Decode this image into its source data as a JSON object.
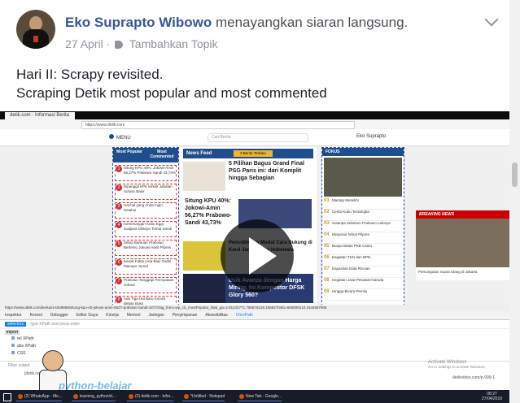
{
  "post": {
    "author_name": "Eko Suprapto Wibowo",
    "author_action": "menayangkan siaran langsung.",
    "date": "27 April",
    "separator": "·",
    "tag_label": "Tambahkan Topik",
    "line1": "Hari II: Scrapy revisited.",
    "line2": "Scraping Detik most popular and most commented"
  },
  "video": {
    "browser_tab": "detik.com - Informasi Berita Terkini",
    "url": "https://www.detik.com",
    "site": {
      "menu": "MENU",
      "search_placeholder": "Cari Berita",
      "user": "Eko Suprapto",
      "popular_tabs": [
        "Most Popular",
        "Most Commented"
      ],
      "popular_items": [
        {
          "n": "1",
          "t": "Situng KPU 40%: Jokowi-Amin 56,27% Prabowo-Sandi 43,73%"
        },
        {
          "n": "2",
          "t": "Dipanggil KPK terkait Jabatan Sofyan Basir"
        },
        {
          "n": "3",
          "t": "Hal-hal yang Anda Ingin Ketahui"
        },
        {
          "n": "4",
          "t": "Kemenangan Kubu Eggi Sudjana Dilanjut Tomat Sandi"
        },
        {
          "n": "5",
          "t": "Sebut Bantuan Prabowo Bertemu Jokowi Hasil Pilpres"
        },
        {
          "n": "6",
          "t": "Kenali Fakta Usia Bayi Gadis Manopo Jurnal"
        },
        {
          "n": "7",
          "t": "Prabowo Tanggapi Pernyataan Jokowi"
        },
        {
          "n": "8",
          "t": "Ada Tiga Hal Baru Komisi Bebas Bukti"
        },
        {
          "n": "9",
          "t": "Fakta Lain Kapal Ketidakrukunan"
        }
      ],
      "newsfeed_title": "News Feed",
      "newsfeed_badge": "3 Berita Terbaru",
      "newsfeed_items": [
        "5 Pilihan Bagus Grand Final PSG Paris ini: dari Komplit hingga Sebagian",
        "Situng KPU 40%: Jokowi-Amin 56,27% Prabowo-Sandi 43,73%",
        "Pencoblosan Modul Cara Dukung di Kecil Jadi Unggul Indonesia",
        "Usik Avanza dengan Harga Miring, Ini Kompetitor DFSK Glory 560?"
      ],
      "fokus_title": "FOKUS",
      "fokus_items": [
        {
          "n": "01",
          "t": "Mantap Memilih!"
        },
        {
          "n": "02",
          "t": "Cerita Kubu Tersangka"
        },
        {
          "n": "03",
          "t": "Sutanpa Sebelum Prabowo Lainnya"
        },
        {
          "n": "04",
          "t": "Eksposur Minat Pilpres"
        },
        {
          "n": "05",
          "t": "Buaya Batas PKB Cantu"
        },
        {
          "n": "06",
          "t": "Kegiatan TKN dan BPN"
        },
        {
          "n": "07",
          "t": "Kapasitas Data Rincian"
        },
        {
          "n": "08",
          "t": "Kegiatan Jasa Pesawat Garuda"
        },
        {
          "n": "09",
          "t": "Hingga Bicara Pemilu"
        }
      ],
      "breaking_title": "BREAKING NEWS",
      "breaking_caption": "Pemungutan Suara Ulang di Jakarta"
    },
    "devtools": {
      "status_url": "https://www.detik.com/berita/d-4539858/situng-kpu-40-jokowi-amin-5627-prabowo-sandi-4373?tag_from=wp_cb_mostPopular_list&_ga=2.91242771.765575218.1556270461-694005210.1544697806",
      "tabs": [
        "Inspektur",
        "Konsol",
        "Debugger",
        "Editor Gaya",
        "Kinerja",
        "Memori",
        "Jaringan",
        "Penyimpanan",
        "Aksesibilitas",
        "ChroPath"
      ],
      "active_tab": "ChroPath",
      "selector_chip": "selectors",
      "selector_placeholder": "type XPath and press enter",
      "import_label": "import",
      "rows": [
        "rel XPath",
        "abs XPath",
        "CSS"
      ],
      "filter_placeholder": "Filter output",
      "hint": "[detik.com/berita] ..."
    },
    "watermark": "python-belajar",
    "activate_title": "Activate Windows",
    "activate_sub": "Go to Settings to activate Windows.",
    "corner_url": "detikvideo.com/p-999-1",
    "taskbar_items": [
      "(2) WhatsApp - Mo...",
      "learning_python/d...",
      "(2) detik.com - Infor...",
      "*Untitled - Notepad",
      "New Tab - Google..."
    ],
    "clock": "08:27",
    "clock_date": "27/04/2019"
  }
}
